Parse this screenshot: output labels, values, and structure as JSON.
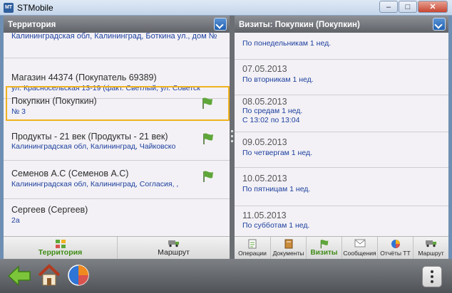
{
  "window": {
    "app_icon": "MT",
    "title": "STMobile",
    "min": "–",
    "max": "□",
    "close": "✕"
  },
  "left_panel": {
    "header": "Территория",
    "items": [
      {
        "line1": "Калининградская обл, Калининград, Боткина ул., дом №",
        "line2": ""
      },
      {
        "line1": "Магазин 44374 (Покупатель 69389)",
        "line2": "ул. Красносельская  13-19 (факт. Светлый, ул. Советск"
      },
      {
        "line1": "Покупкин (Покупкин)",
        "line2": "№ 3"
      },
      {
        "line1": "Продукты - 21 век (Продукты - 21 век)",
        "line2": "Калининградская обл, Калининград, Чайковско"
      },
      {
        "line1": "Семенов А.С (Семенов А.С)",
        "line2": "Калининградская обл, Калининград, Согласия, ,"
      },
      {
        "line1": "Сергеев (Сергеев)",
        "line2": "2а"
      }
    ],
    "tabs": [
      {
        "label": "Территория",
        "icon": "territory-icon"
      },
      {
        "label": "Маршрут",
        "icon": "route-truck-icon"
      }
    ]
  },
  "right_panel": {
    "header": "Визиты: Покупкин (Покупкин)",
    "visits": [
      {
        "date": "",
        "lines": [
          "По понедельникам 1 нед."
        ]
      },
      {
        "date": "07.05.2013",
        "lines": [
          "По вторникам 1 нед."
        ]
      },
      {
        "date": "08.05.2013",
        "lines": [
          "По средам 1 нед.",
          "С 13:02 по 13:04"
        ]
      },
      {
        "date": "09.05.2013",
        "lines": [
          "По четвергам 1 нед."
        ]
      },
      {
        "date": "10.05.2013",
        "lines": [
          "По пятницам 1 нед."
        ]
      },
      {
        "date": "11.05.2013",
        "lines": [
          "По субботам 1 нед."
        ]
      }
    ],
    "tabs": [
      {
        "label": "Операции",
        "icon": "operations-icon"
      },
      {
        "label": "Документы",
        "icon": "documents-icon"
      },
      {
        "label": "Визиты",
        "icon": "visits-flag-icon"
      },
      {
        "label": "Сообщения",
        "icon": "messages-icon"
      },
      {
        "label": "Отчёты ТТ",
        "icon": "reports-pie-icon"
      },
      {
        "label": "Маршрут",
        "icon": "route-truck-icon"
      }
    ]
  },
  "colors": {
    "active_tab": "#3d8b14",
    "selection_border": "#f0b21f",
    "link_text": "#1c3f9e",
    "flag": "#5fa63a"
  }
}
